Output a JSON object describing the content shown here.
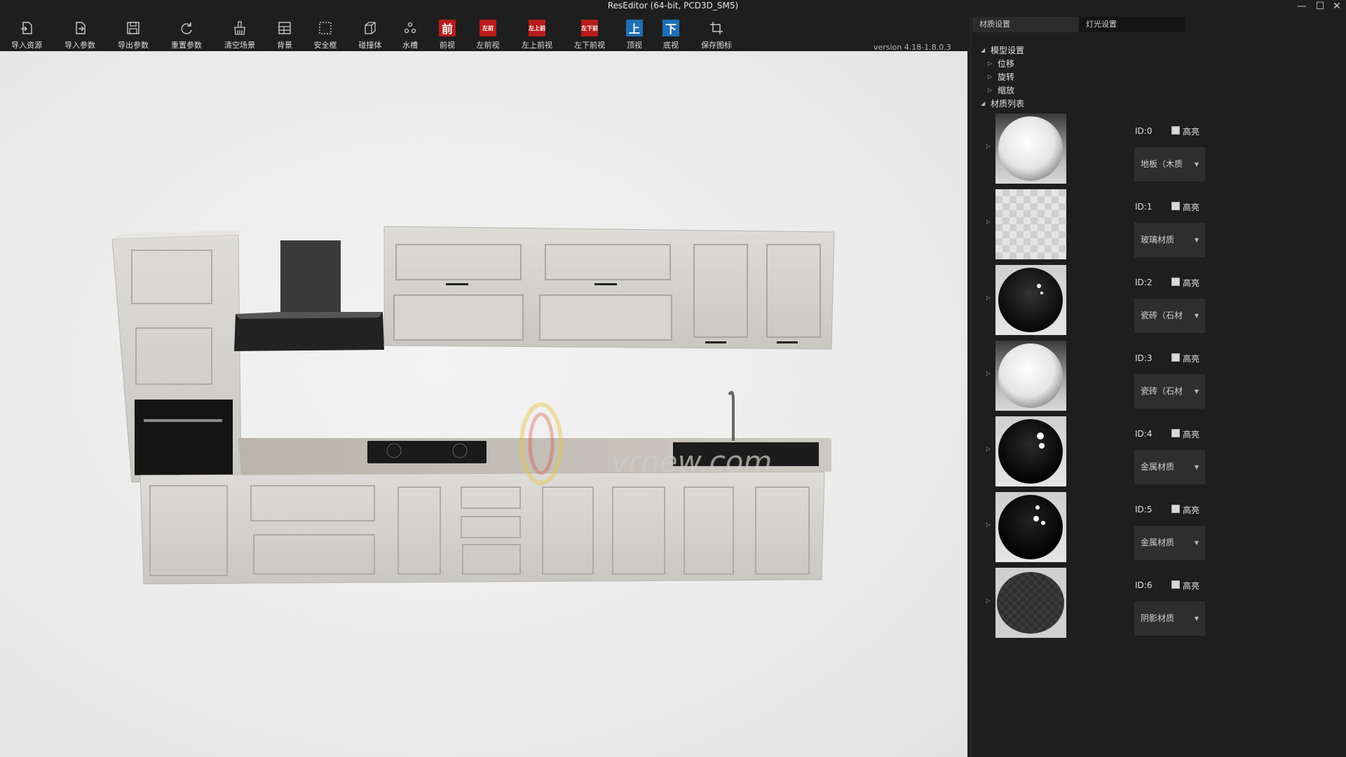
{
  "window": {
    "title": "ResEditor (64-bit, PCD3D_SM5)",
    "controls": [
      "—",
      "☐",
      "✕"
    ]
  },
  "toolbar": {
    "items": [
      {
        "label": "导入资源",
        "icon": "import-resource-icon"
      },
      {
        "label": "导入参数",
        "icon": "import-params-icon"
      },
      {
        "label": "导出参数",
        "icon": "export-params-icon"
      },
      {
        "label": "重置参数",
        "icon": "reset-params-icon"
      },
      {
        "label": "清空场景",
        "icon": "clear-scene-icon"
      },
      {
        "label": "背景",
        "icon": "background-icon"
      },
      {
        "label": "安全框",
        "icon": "safe-frame-icon"
      },
      {
        "label": "碰撞体",
        "icon": "collider-icon"
      },
      {
        "label": "水槽",
        "icon": "sink-icon"
      },
      {
        "label": "前视",
        "icon": "front-view-icon",
        "glyph": "前"
      },
      {
        "label": "左前视",
        "icon": "left-front-view-icon",
        "glyph": "左前"
      },
      {
        "label": "左上前视",
        "icon": "left-top-front-view-icon",
        "glyph": "左上前"
      },
      {
        "label": "左下前视",
        "icon": "left-bottom-front-view-icon",
        "glyph": "左下前"
      },
      {
        "label": "顶视",
        "icon": "top-view-icon",
        "glyph": "上"
      },
      {
        "label": "底视",
        "icon": "bottom-view-icon",
        "glyph": "下"
      },
      {
        "label": "保存图标",
        "icon": "save-icon-icon"
      }
    ],
    "version": "version 4.18-1.8.0.3"
  },
  "panel": {
    "tabs": [
      {
        "label": "材质设置",
        "active": false
      },
      {
        "label": "灯光设置",
        "active": true
      }
    ],
    "tree": {
      "model_settings": "模型设置",
      "position": "位移",
      "rotation": "旋转",
      "scale": "缩放",
      "material_list": "材质列表"
    },
    "materials": [
      {
        "id": "ID:0",
        "highlight": "高亮",
        "type": "地板（木质",
        "swatch": "white-sphere"
      },
      {
        "id": "ID:1",
        "highlight": "高亮",
        "type": "玻璃材质",
        "swatch": "checker-plane"
      },
      {
        "id": "ID:2",
        "highlight": "高亮",
        "type": "瓷砖（石材",
        "swatch": "black-sphere"
      },
      {
        "id": "ID:3",
        "highlight": "高亮",
        "type": "瓷砖（石材",
        "swatch": "white-sphere"
      },
      {
        "id": "ID:4",
        "highlight": "高亮",
        "type": "金属材质",
        "swatch": "black-sphere"
      },
      {
        "id": "ID:5",
        "highlight": "高亮",
        "type": "金属材质",
        "swatch": "black-sphere-spots"
      },
      {
        "id": "ID:6",
        "highlight": "高亮",
        "type": "阴影材质",
        "swatch": "dark-checker"
      }
    ]
  },
  "viewport": {
    "watermark": "vrnew.com"
  },
  "colors": {
    "background": "#1e1e1e",
    "panel_tab_active": "#141414",
    "view_red": "#b81c1c",
    "view_blue": "#1f6fb6"
  }
}
